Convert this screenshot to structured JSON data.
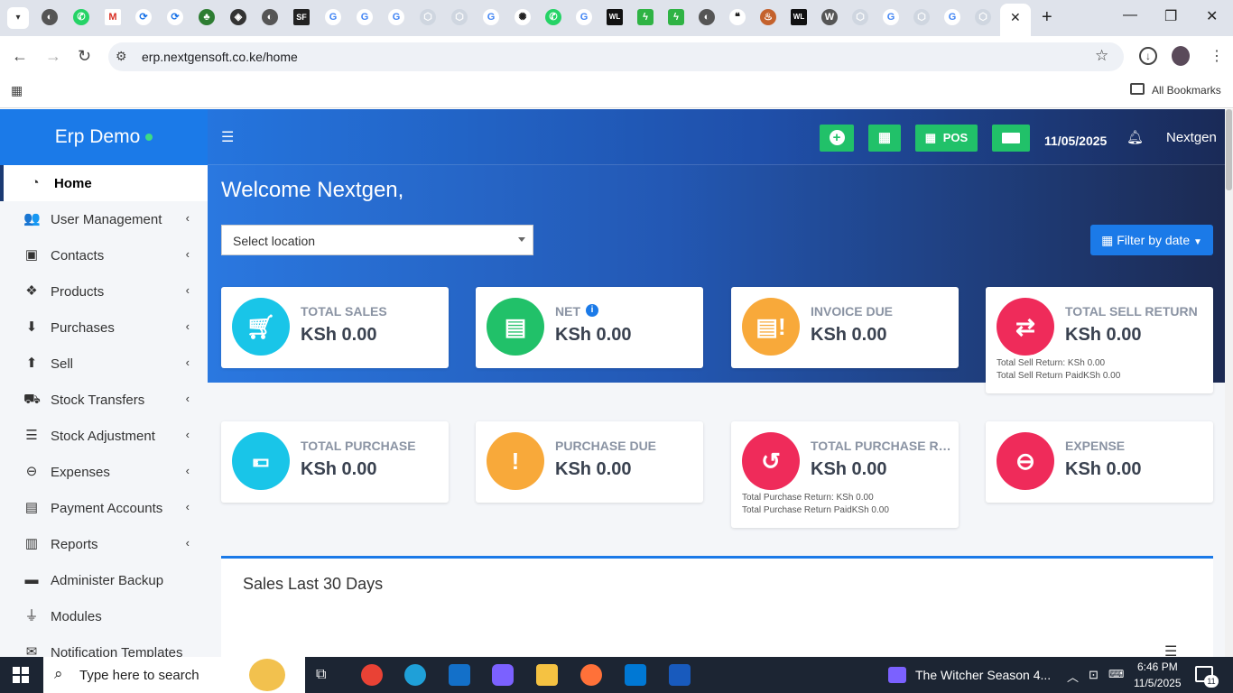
{
  "browser": {
    "url": "erp.nextgensoft.co.ke/home",
    "bookmarks_label": "All Bookmarks"
  },
  "app": {
    "brand": "Erp Demo",
    "header": {
      "pos_label": "POS",
      "date": "11/05/2025",
      "user": "Nextgen"
    },
    "welcome": "Welcome Nextgen,",
    "location_placeholder": "Select location",
    "filter_label": "Filter by date",
    "sales_title": "Sales Last 30 Days"
  },
  "sidebar": {
    "items": [
      {
        "label": "Home",
        "icon": "dashboard-icon",
        "active": true
      },
      {
        "label": "User Management",
        "icon": "users-icon"
      },
      {
        "label": "Contacts",
        "icon": "address-book-icon"
      },
      {
        "label": "Products",
        "icon": "cubes-icon"
      },
      {
        "label": "Purchases",
        "icon": "arrow-circle-down-icon"
      },
      {
        "label": "Sell",
        "icon": "arrow-circle-up-icon"
      },
      {
        "label": "Stock Transfers",
        "icon": "truck-icon"
      },
      {
        "label": "Stock Adjustment",
        "icon": "database-icon"
      },
      {
        "label": "Expenses",
        "icon": "minus-circle-icon"
      },
      {
        "label": "Payment Accounts",
        "icon": "money-check-icon"
      },
      {
        "label": "Reports",
        "icon": "bar-chart-icon"
      },
      {
        "label": "Administer Backup",
        "icon": "hdd-icon"
      },
      {
        "label": "Modules",
        "icon": "plug-icon"
      },
      {
        "label": "Notification Templates",
        "icon": "envelope-icon"
      }
    ]
  },
  "cards": {
    "total_sales": {
      "label": "TOTAL SALES",
      "value": "KSh 0.00"
    },
    "net": {
      "label": "NET",
      "value": "KSh 0.00"
    },
    "invoice_due": {
      "label": "INVOICE DUE",
      "value": "KSh 0.00"
    },
    "total_sell_return": {
      "label": "TOTAL SELL RETURN",
      "value": "KSh 0.00",
      "note1": "Total Sell Return: KSh 0.00",
      "note2": "Total Sell Return PaidKSh 0.00"
    },
    "total_purchase": {
      "label": "TOTAL PURCHASE",
      "value": "KSh 0.00"
    },
    "purchase_due": {
      "label": "PURCHASE DUE",
      "value": "KSh 0.00"
    },
    "total_purchase_return": {
      "label": "TOTAL PURCHASE RET...",
      "value": "KSh 0.00",
      "note1": "Total Purchase Return: KSh 0.00",
      "note2": "Total Purchase Return PaidKSh 0.00"
    },
    "expense": {
      "label": "EXPENSE",
      "value": "KSh 0.00"
    }
  },
  "taskbar": {
    "search_placeholder": "Type here to search",
    "media_title": "The Witcher Season 4...",
    "time": "6:46 PM",
    "date": "11/5/2025",
    "notification_count": "11"
  },
  "colors": {
    "brand_blue": "#1b7ae8",
    "green": "#21c169",
    "cyan": "#19c5e8",
    "orange": "#f8a93a",
    "red": "#ef2b5a"
  }
}
